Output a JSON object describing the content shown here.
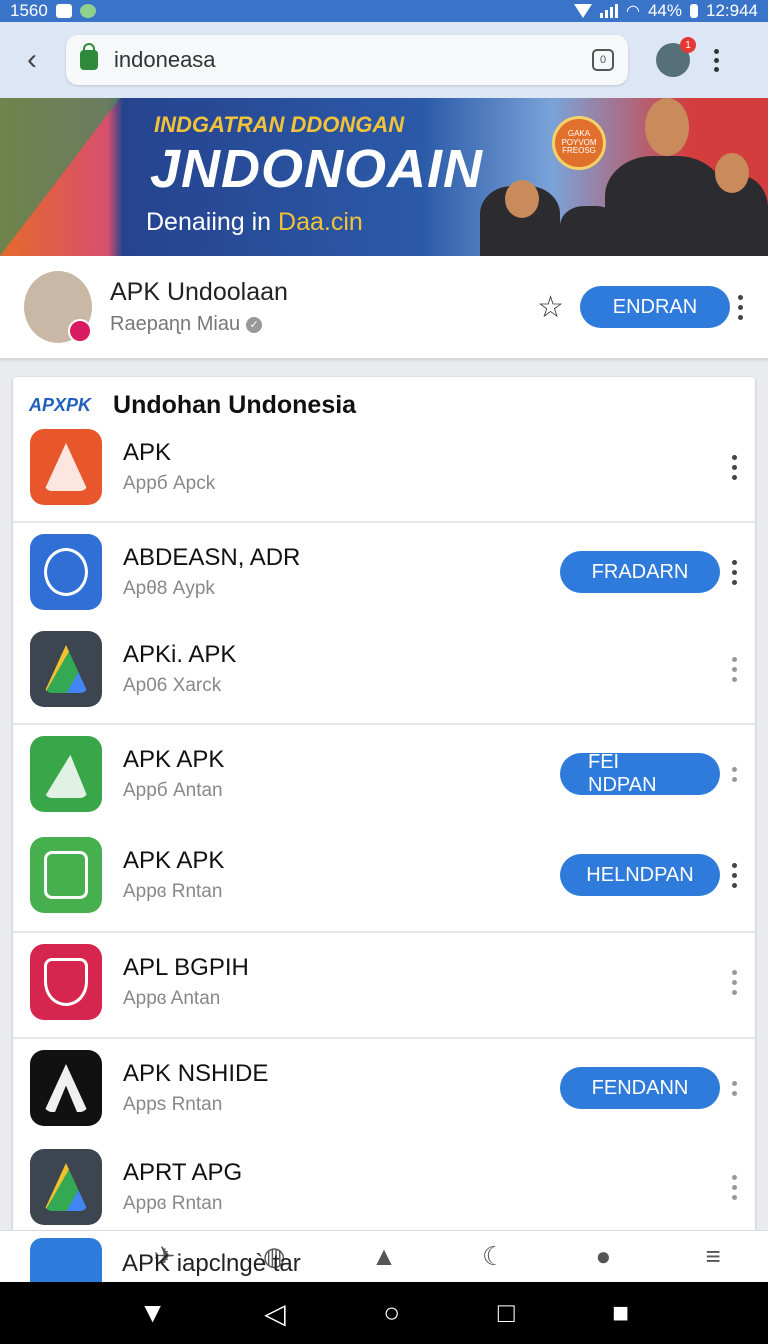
{
  "status_bar": {
    "time_left": "1560",
    "battery": "44%",
    "time": "12:944"
  },
  "browser": {
    "url": "indoneasa",
    "tab_count": "0",
    "notification_count": "1"
  },
  "banner": {
    "supertitle": "INDGATRAN DDONGAN",
    "title": "JNDONOAIN",
    "subtitle_prefix": "Denaiing in",
    "subtitle_highlight": "Daa.cin",
    "seal_text": "GAKA POYVOM FREOSG"
  },
  "channel": {
    "name": "APK Undoolaan",
    "subtitle": "Raepaɳn Miau",
    "button": "ENDRAN"
  },
  "list": {
    "logo": "APXPK",
    "title": "Undohan Undonesia",
    "apps": [
      {
        "name": "APK",
        "sub": "Appб Apck",
        "button": "",
        "icon_color": "#e8572b"
      },
      {
        "name": "ABDEASN, ADR",
        "sub": "Apθ8 Aуpk",
        "button": "FRADARN",
        "icon_color": "#2f6fd6"
      },
      {
        "name": "APKi. APK",
        "sub": "Ap06 Xarck",
        "button": "",
        "icon_color": "#3d4550"
      },
      {
        "name": "APK APK",
        "sub": "Appб Antan",
        "button": "FEI NDPAN",
        "icon_color": "#3aa64a"
      },
      {
        "name": "APK APK",
        "sub": "Appɞ Rntan",
        "button": "HELNDPAN",
        "icon_color": "#46b04f"
      },
      {
        "name": "APL BGPIH",
        "sub": "Appɞ Antan",
        "button": "",
        "icon_color": "#d6264f"
      },
      {
        "name": "APK NSHIDE",
        "sub": "Apps Rntan",
        "button": "FENDANN",
        "icon_color": "#111111"
      },
      {
        "name": "APRT APG",
        "sub": "Appɞ Rntan",
        "button": "",
        "icon_color": "#3d4550"
      }
    ]
  },
  "peek_text": "AРK iapclngè tar",
  "bottom_nav": [
    "close-icon",
    "plane-icon",
    "globe-icon",
    "apps-icon",
    "moon-icon",
    "profile-icon",
    "menu-icon"
  ],
  "system_nav": {
    "down": "▼",
    "back": "◁",
    "home": "○",
    "recents": "□",
    "extra": "■"
  }
}
